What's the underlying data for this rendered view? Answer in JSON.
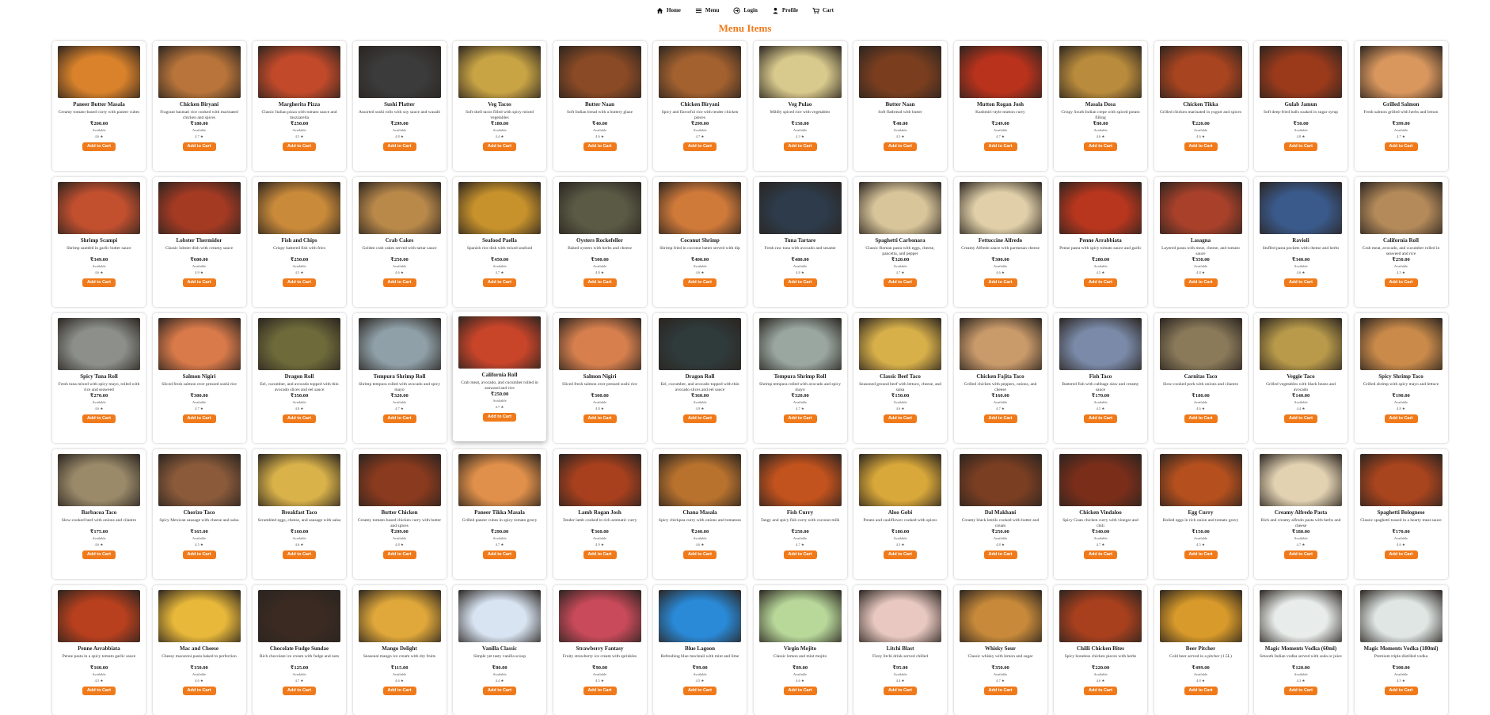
{
  "nav": [
    {
      "label": "Home",
      "icon": "home-icon"
    },
    {
      "label": "Menu",
      "icon": "menu-icon"
    },
    {
      "label": "Login",
      "icon": "login-icon"
    },
    {
      "label": "Profile",
      "icon": "profile-icon"
    },
    {
      "label": "Cart",
      "icon": "cart-icon"
    }
  ],
  "title": "Menu Items",
  "accent_color": "#f07a1a",
  "add_label": "Add to Cart",
  "items": [
    {
      "name": "Paneer Butter Masala",
      "desc": "Creamy tomato-based curry with paneer cubes",
      "price": "₹200.00",
      "avail": "Available",
      "rating": "4.6 ★",
      "color": "#d9822b"
    },
    {
      "name": "Chicken Biryani",
      "desc": "Fragrant basmati rice cooked with marinated chicken and spices",
      "price": "₹180.00",
      "avail": "Available",
      "rating": "4.7 ★",
      "color": "#b8743a"
    },
    {
      "name": "Margherita Pizza",
      "desc": "Classic Italian pizza with tomato sauce and mozzarella",
      "price": "₹250.00",
      "avail": "Available",
      "rating": "4.5 ★",
      "color": "#c24a2a"
    },
    {
      "name": "Sushi Platter",
      "desc": "Assorted sushi rolls with soy sauce and wasabi",
      "price": "₹299.00",
      "avail": "Available",
      "rating": "4.8 ★",
      "color": "#3b3b3b"
    },
    {
      "name": "Veg Tacos",
      "desc": "Soft shell tacos filled with spicy mixed vegetables",
      "price": "₹180.00",
      "avail": "Available",
      "rating": "4.4 ★",
      "color": "#c9a445"
    },
    {
      "name": "Butter Naan",
      "desc": "Soft Indian bread with a buttery glaze",
      "price": "₹40.00",
      "avail": "Available",
      "rating": "4.6 ★",
      "color": "#8a4a25"
    },
    {
      "name": "Chicken Biryani",
      "desc": "Spicy and flavorful rice with tender chicken pieces",
      "price": "₹299.00",
      "avail": "Available",
      "rating": "4.7 ★",
      "color": "#a3612f"
    },
    {
      "name": "Veg Pulao",
      "desc": "Mildly spiced rice with vegetables",
      "price": "₹150.00",
      "avail": "Available",
      "rating": "4.3 ★",
      "color": "#d8c98c"
    },
    {
      "name": "Butter Naan",
      "desc": "Soft flatbread with butter",
      "price": "₹40.00",
      "avail": "Available",
      "rating": "4.5 ★",
      "color": "#7a3e1f"
    },
    {
      "name": "Mutton Rogan Josh",
      "desc": "Kashmiri-style mutton curry",
      "price": "₹249.00",
      "avail": "Available",
      "rating": "4.7 ★",
      "color": "#b8321c"
    },
    {
      "name": "Masala Dosa",
      "desc": "Crispy South Indian crepe with spiced potato filling",
      "price": "₹80.00",
      "avail": "Available",
      "rating": "4.6 ★",
      "color": "#b98b3c"
    },
    {
      "name": "Chicken Tikka",
      "desc": "Grilled chicken marinated in yogurt and spices",
      "price": "₹220.00",
      "avail": "Available",
      "rating": "4.6 ★",
      "color": "#a8441f"
    },
    {
      "name": "Gulab Jamun",
      "desc": "Soft deep-fried balls soaked in sugar syrup",
      "price": "₹50.00",
      "avail": "Available",
      "rating": "4.8 ★",
      "color": "#9b3a1b"
    },
    {
      "name": "Grilled Salmon",
      "desc": "Fresh salmon grilled with herbs and lemon",
      "price": "₹399.00",
      "avail": "Available",
      "rating": "4.7 ★",
      "color": "#d9975e"
    },
    {
      "name": "Shrimp Scampi",
      "desc": "Shrimp sautéed in garlic butter sauce",
      "price": "₹349.00",
      "avail": "Available",
      "rating": "4.6 ★",
      "color": "#c2502f"
    },
    {
      "name": "Lobster Thermidor",
      "desc": "Classic lobster dish with creamy sauce",
      "price": "₹600.00",
      "avail": "Available",
      "rating": "4.9 ★",
      "color": "#a53a23"
    },
    {
      "name": "Fish and Chips",
      "desc": "Crispy battered fish with fries",
      "price": "₹250.00",
      "avail": "Available",
      "rating": "4.5 ★",
      "color": "#c98a3a"
    },
    {
      "name": "Crab Cakes",
      "desc": "Golden crab cakes served with tartar sauce",
      "price": "₹250.00",
      "avail": "Available",
      "rating": "4.6 ★",
      "color": "#b9894a"
    },
    {
      "name": "Seafood Paella",
      "desc": "Spanish rice dish with mixed seafood",
      "price": "₹450.00",
      "avail": "Available",
      "rating": "4.7 ★",
      "color": "#c7922c"
    },
    {
      "name": "Oysters Rockefeller",
      "desc": "Baked oysters with herbs and cheese",
      "price": "₹500.00",
      "avail": "Available",
      "rating": "4.8 ★",
      "color": "#5b5a45"
    },
    {
      "name": "Coconut Shrimp",
      "desc": "Shrimp fried in coconut batter served with dip",
      "price": "₹400.00",
      "avail": "Available",
      "rating": "4.6 ★",
      "color": "#d07a3a"
    },
    {
      "name": "Tuna Tartare",
      "desc": "Fresh raw tuna with avocado and sesame",
      "price": "₹480.00",
      "avail": "Available",
      "rating": "4.8 ★",
      "color": "#2d3b4a"
    },
    {
      "name": "Spaghetti Carbonara",
      "desc": "Classic Roman pasta with eggs, cheese, pancetta, and pepper",
      "price": "₹320.00",
      "avail": "Available",
      "rating": "4.7 ★",
      "color": "#d8c59a"
    },
    {
      "name": "Fettuccine Alfredo",
      "desc": "Creamy Alfredo sauce with parmesan cheese",
      "price": "₹300.00",
      "avail": "Available",
      "rating": "4.6 ★",
      "color": "#e0cfa8"
    },
    {
      "name": "Penne Arrabbiata",
      "desc": "Penne pasta with spicy tomato sauce and garlic",
      "price": "₹280.00",
      "avail": "Available",
      "rating": "4.5 ★",
      "color": "#b8361e"
    },
    {
      "name": "Lasagna",
      "desc": "Layered pasta with meat, cheese, and tomato sauce",
      "price": "₹350.00",
      "avail": "Available",
      "rating": "4.8 ★",
      "color": "#a9412a"
    },
    {
      "name": "Ravioli",
      "desc": "Stuffed pasta pockets with cheese and herbs",
      "price": "₹340.00",
      "avail": "Available",
      "rating": "4.6 ★",
      "color": "#3a5a8c"
    },
    {
      "name": "California Roll",
      "desc": "Crab meat, avocado, and cucumber rolled in seaweed and rice",
      "price": "₹250.00",
      "avail": "Available",
      "rating": "4.5 ★",
      "color": "#b48a5a"
    },
    {
      "name": "Spicy Tuna Roll",
      "desc": "Fresh tuna mixed with spicy mayo, rolled with rice and seaweed",
      "price": "₹270.00",
      "avail": "Available",
      "rating": "4.6 ★",
      "color": "#8c8f8a"
    },
    {
      "name": "Salmon Nigiri",
      "desc": "Sliced fresh salmon over pressed sushi rice",
      "price": "₹300.00",
      "avail": "Available",
      "rating": "4.7 ★",
      "color": "#d97a4a"
    },
    {
      "name": "Dragon Roll",
      "desc": "Eel, cucumber, and avocado topped with thin avocado slices and eel sauce",
      "price": "₹350.00",
      "avail": "Available",
      "rating": "4.8 ★",
      "color": "#6e6a3a"
    },
    {
      "name": "Tempura Shrimp Roll",
      "desc": "Shrimp tempura rolled with avocado and spicy mayo",
      "price": "₹320.00",
      "avail": "Available",
      "rating": "4.7 ★",
      "color": "#8fa0a8"
    },
    {
      "name": "California Roll",
      "desc": "Crab meat, avocado, and cucumber rolled in seaweed and rice",
      "price": "₹250.00",
      "avail": "Available",
      "rating": "4.7 ★",
      "color": "#c9452a"
    },
    {
      "name": "Salmon Nigiri",
      "desc": "Sliced fresh salmon over pressed sushi rice",
      "price": "₹300.00",
      "avail": "Available",
      "rating": "4.8 ★",
      "color": "#d7804e"
    },
    {
      "name": "Dragon Roll",
      "desc": "Eel, cucumber, and avocado topped with thin avocado slices and eel sauce",
      "price": "₹360.00",
      "avail": "Available",
      "rating": "4.9 ★",
      "color": "#2f3a3a"
    },
    {
      "name": "Tempura Shrimp Roll",
      "desc": "Shrimp tempura rolled with avocado and spicy mayo",
      "price": "₹320.00",
      "avail": "Available",
      "rating": "4.7 ★",
      "color": "#9aa7a0"
    },
    {
      "name": "Classic Beef Taco",
      "desc": "Seasoned ground beef with lettuce, cheese, and salsa",
      "price": "₹150.00",
      "avail": "Available",
      "rating": "4.6 ★",
      "color": "#d8b04a"
    },
    {
      "name": "Chicken Fajita Taco",
      "desc": "Grilled chicken with peppers, onions, and cheese",
      "price": "₹160.00",
      "avail": "Available",
      "rating": "4.7 ★",
      "color": "#c99a6a"
    },
    {
      "name": "Fish Taco",
      "desc": "Battered fish with cabbage slaw and creamy sauce",
      "price": "₹170.00",
      "avail": "Available",
      "rating": "4.5 ★",
      "color": "#7a8aa8"
    },
    {
      "name": "Carnitas Taco",
      "desc": "Slow-cooked pork with onions and cilantro",
      "price": "₹180.00",
      "avail": "Available",
      "rating": "4.6 ★",
      "color": "#8a7a5a"
    },
    {
      "name": "Veggie Taco",
      "desc": "Grilled vegetables with black beans and avocado",
      "price": "₹140.00",
      "avail": "Available",
      "rating": "4.4 ★",
      "color": "#b89a4a"
    },
    {
      "name": "Spicy Shrimp Taco",
      "desc": "Grilled shrimp with spicy mayo and lettuce",
      "price": "₹190.00",
      "avail": "Available",
      "rating": "4.8 ★",
      "color": "#c98a4a"
    },
    {
      "name": "Barbacoa Taco",
      "desc": "Slow-cooked beef with onions and cilantro",
      "price": "₹175.00",
      "avail": "Available",
      "rating": "4.6 ★",
      "color": "#9a8a6a"
    },
    {
      "name": "Chorizo Taco",
      "desc": "Spicy Mexican sausage with cheese and salsa",
      "price": "₹165.00",
      "avail": "Available",
      "rating": "4.5 ★",
      "color": "#8a5a3a"
    },
    {
      "name": "Breakfast Taco",
      "desc": "Scrambled eggs, cheese, and sausage with salsa",
      "price": "₹160.00",
      "avail": "Available",
      "rating": "4.6 ★",
      "color": "#d9b24a"
    },
    {
      "name": "Butter Chicken",
      "desc": "Creamy tomato-based chicken curry with butter and spices",
      "price": "₹299.00",
      "avail": "Available",
      "rating": "4.8 ★",
      "color": "#8a3a1e"
    },
    {
      "name": "Paneer Tikka Masala",
      "desc": "Grilled paneer cubes in spicy tomato gravy",
      "price": "₹290.00",
      "avail": "Available",
      "rating": "4.7 ★",
      "color": "#e0904a"
    },
    {
      "name": "Lamb Rogan Josh",
      "desc": "Tender lamb cooked in rich aromatic curry",
      "price": "₹360.00",
      "avail": "Available",
      "rating": "4.9 ★",
      "color": "#a8401e"
    },
    {
      "name": "Chana Masala",
      "desc": "Spicy chickpea curry with onions and tomatoes",
      "price": "₹240.00",
      "avail": "Available",
      "rating": "4.6 ★",
      "color": "#b8722e"
    },
    {
      "name": "Fish Curry",
      "desc": "Tangy and spicy fish curry with coconut milk",
      "price": "₹250.00",
      "avail": "Available",
      "rating": "4.7 ★",
      "color": "#c2521e"
    },
    {
      "name": "Aloo Gobi",
      "desc": "Potato and cauliflower cooked with spices",
      "price": "₹180.00",
      "avail": "Available",
      "rating": "4.5 ★",
      "color": "#d9a83a"
    },
    {
      "name": "Dal Makhani",
      "desc": "Creamy black lentils cooked with butter and cream",
      "price": "₹250.00",
      "avail": "Available",
      "rating": "4.8 ★",
      "color": "#7a3e22"
    },
    {
      "name": "Chicken Vindaloo",
      "desc": "Spicy Goan chicken curry with vinegar and chili",
      "price": "₹340.00",
      "avail": "Available",
      "rating": "4.7 ★",
      "color": "#7a2e1a"
    },
    {
      "name": "Egg Curry",
      "desc": "Boiled eggs in rich onion and tomato gravy",
      "price": "₹150.00",
      "avail": "Available",
      "rating": "4.5 ★",
      "color": "#b5501e"
    },
    {
      "name": "Creamy Alfredo Pasta",
      "desc": "Rich and creamy alfredo pasta with herbs and cheese",
      "price": "₹180.00",
      "avail": "Available",
      "rating": "4.7 ★",
      "color": "#e2d2b2"
    },
    {
      "name": "Spaghetti Bolognese",
      "desc": "Classic spaghetti tossed in a hearty meat sauce",
      "price": "₹170.00",
      "avail": "Available",
      "rating": "4.6 ★",
      "color": "#a8441e"
    },
    {
      "name": "Penne Arrabbiata",
      "desc": "Penne pasta in a spicy tomato garlic sauce",
      "price": "₹160.00",
      "avail": "Available",
      "rating": "4.5 ★",
      "color": "#b8401e"
    },
    {
      "name": "Mac and Cheese",
      "desc": "Cheesy macaroni pasta baked to perfection",
      "price": "₹150.00",
      "avail": "Available",
      "rating": "4.6 ★",
      "color": "#e8b83a"
    },
    {
      "name": "Chocolate Fudge Sundae",
      "desc": "Rich chocolate ice cream with fudge and nuts",
      "price": "₹125.00",
      "avail": "Available",
      "rating": "4.7 ★",
      "color": "#3a2a22"
    },
    {
      "name": "Mango Delight",
      "desc": "Seasonal mango ice cream with dry fruits",
      "price": "₹115.00",
      "avail": "Available",
      "rating": "4.6 ★",
      "color": "#e0a83a"
    },
    {
      "name": "Vanilla Classic",
      "desc": "Simple yet tasty vanilla scoop",
      "price": "₹80.00",
      "avail": "Available",
      "rating": "4.4 ★",
      "color": "#d8e4f2"
    },
    {
      "name": "Strawberry Fantasy",
      "desc": "Fruity strawberry ice cream with sprinkles",
      "price": "₹90.00",
      "avail": "Available",
      "rating": "4.5 ★",
      "color": "#c94a5a"
    },
    {
      "name": "Blue Lagoon",
      "desc": "Refreshing blue mocktail with mint and lime",
      "price": "₹99.00",
      "avail": "Available",
      "rating": "4.5 ★",
      "color": "#2a8ad8"
    },
    {
      "name": "Virgin Mojito",
      "desc": "Classic lemon and mint mojito",
      "price": "₹89.00",
      "avail": "Available",
      "rating": "4.6 ★",
      "color": "#b8d89a"
    },
    {
      "name": "Litchi Blast",
      "desc": "Fizzy litchi drink served chilled",
      "price": "₹95.00",
      "avail": "Available",
      "rating": "4.4 ★",
      "color": "#e8c8c0"
    },
    {
      "name": "Whisky Sour",
      "desc": "Classic whisky with lemon and sugar",
      "price": "₹350.00",
      "avail": "Available",
      "rating": "4.7 ★",
      "color": "#c88a3a"
    },
    {
      "name": "Chilli Chicken Bites",
      "desc": "Spicy boneless chicken pieces with herbs",
      "price": "₹220.00",
      "avail": "Available",
      "rating": "4.6 ★",
      "color": "#a8401e"
    },
    {
      "name": "Beer Pitcher",
      "desc": "Cold beer served in a pitcher (1.5L)",
      "price": "₹499.00",
      "avail": "Available",
      "rating": "4.8 ★",
      "color": "#d89a2a"
    },
    {
      "name": "Magic Moments Vodka (60ml)",
      "desc": "Smooth Indian vodka served with soda or juice",
      "price": "₹120.00",
      "avail": "Available",
      "rating": "4.3 ★",
      "color": "#e8ecea"
    },
    {
      "name": "Magic Moments Vodka (180ml)",
      "desc": "Premium triple-distilled vodka",
      "price": "₹300.00",
      "avail": "Available",
      "rating": "4.5 ★",
      "color": "#dfe6e4"
    }
  ]
}
